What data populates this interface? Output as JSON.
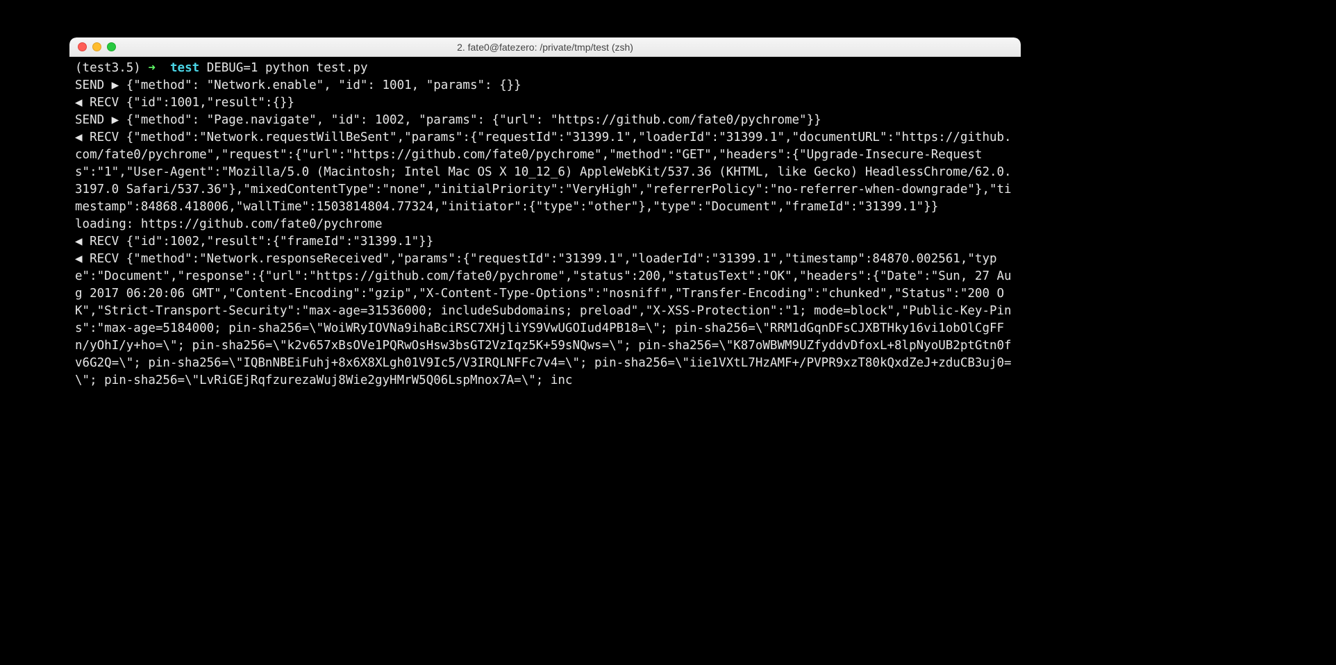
{
  "window": {
    "title": "2. fate0@fatezero: /private/tmp/test (zsh)"
  },
  "prompt": {
    "venv": "(test3.5)",
    "arrow": "➜",
    "dir": "test",
    "command": "DEBUG=1 python test.py"
  },
  "lines": [
    "SEND ▶ {\"method\": \"Network.enable\", \"id\": 1001, \"params\": {}}",
    "◀ RECV {\"id\":1001,\"result\":{}}",
    "SEND ▶ {\"method\": \"Page.navigate\", \"id\": 1002, \"params\": {\"url\": \"https://github.com/fate0/pychrome\"}}",
    "◀ RECV {\"method\":\"Network.requestWillBeSent\",\"params\":{\"requestId\":\"31399.1\",\"loaderId\":\"31399.1\",\"documentURL\":\"https://github.com/fate0/pychrome\",\"request\":{\"url\":\"https://github.com/fate0/pychrome\",\"method\":\"GET\",\"headers\":{\"Upgrade-Insecure-Requests\":\"1\",\"User-Agent\":\"Mozilla/5.0 (Macintosh; Intel Mac OS X 10_12_6) AppleWebKit/537.36 (KHTML, like Gecko) HeadlessChrome/62.0.3197.0 Safari/537.36\"},\"mixedContentType\":\"none\",\"initialPriority\":\"VeryHigh\",\"referrerPolicy\":\"no-referrer-when-downgrade\"},\"timestamp\":84868.418006,\"wallTime\":1503814804.77324,\"initiator\":{\"type\":\"other\"},\"type\":\"Document\",\"frameId\":\"31399.1\"}}",
    "loading: https://github.com/fate0/pychrome",
    "◀ RECV {\"id\":1002,\"result\":{\"frameId\":\"31399.1\"}}",
    "◀ RECV {\"method\":\"Network.responseReceived\",\"params\":{\"requestId\":\"31399.1\",\"loaderId\":\"31399.1\",\"timestamp\":84870.002561,\"type\":\"Document\",\"response\":{\"url\":\"https://github.com/fate0/pychrome\",\"status\":200,\"statusText\":\"OK\",\"headers\":{\"Date\":\"Sun, 27 Aug 2017 06:20:06 GMT\",\"Content-Encoding\":\"gzip\",\"X-Content-Type-Options\":\"nosniff\",\"Transfer-Encoding\":\"chunked\",\"Status\":\"200 OK\",\"Strict-Transport-Security\":\"max-age=31536000; includeSubdomains; preload\",\"X-XSS-Protection\":\"1; mode=block\",\"Public-Key-Pins\":\"max-age=5184000; pin-sha256=\\\"WoiWRyIOVNa9ihaBciRSC7XHjliYS9VwUGOIud4PB18=\\\"; pin-sha256=\\\"RRM1dGqnDFsCJXBTHky16vi1obOlCgFFn/yOhI/y+ho=\\\"; pin-sha256=\\\"k2v657xBsOVe1PQRwOsHsw3bsGT2VzIqz5K+59sNQws=\\\"; pin-sha256=\\\"K87oWBWM9UZfyddvDfoxL+8lpNyoUB2ptGtn0fv6G2Q=\\\"; pin-sha256=\\\"IQBnNBEiFuhj+8x6X8XLgh01V9Ic5/V3IRQLNFFc7v4=\\\"; pin-sha256=\\\"iie1VXtL7HzAMF+/PVPR9xzT80kQxdZeJ+zduCB3uj0=\\\"; pin-sha256=\\\"LvRiGEjRqfzurezaWuj8Wie2gyHMrW5Q06LspMnox7A=\\\"; inc"
  ]
}
